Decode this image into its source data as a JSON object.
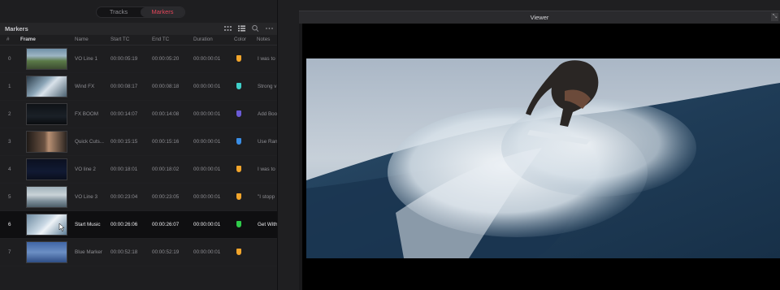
{
  "tabs": {
    "tracks": "Tracks",
    "markers": "Markers"
  },
  "markers_panel": {
    "title": "Markers",
    "columns": {
      "idx": "#",
      "frame": "Frame",
      "name": "Name",
      "start": "Start TC",
      "end": "End TC",
      "duration": "Duration",
      "color": "Color",
      "notes": "Notes"
    },
    "rows": [
      {
        "idx": "0",
        "name": "VO Line 1",
        "start": "00:00:05:19",
        "end": "00:00:05:20",
        "duration": "00:00:00:01",
        "color": "#f2a52b",
        "note": "I was to"
      },
      {
        "idx": "1",
        "name": "Wind FX",
        "start": "00:00:08:17",
        "end": "00:00:08:18",
        "duration": "00:00:00:01",
        "color": "#3fd0c9",
        "note": "Strong v"
      },
      {
        "idx": "2",
        "name": "FX BOOM",
        "start": "00:00:14:07",
        "end": "00:00:14:08",
        "duration": "00:00:00:01",
        "color": "#6b5bd6",
        "note": "Add Boo"
      },
      {
        "idx": "3",
        "name": "Quick Cuts...",
        "start": "00:00:15:15",
        "end": "00:00:15:16",
        "duration": "00:00:00:01",
        "color": "#3a8ee6",
        "note": "Use Ran"
      },
      {
        "idx": "4",
        "name": "VO line 2",
        "start": "00:00:18:01",
        "end": "00:00:18:02",
        "duration": "00:00:00:01",
        "color": "#f2a52b",
        "note": "I was to"
      },
      {
        "idx": "5",
        "name": "VO Line 3",
        "start": "00:00:23:04",
        "end": "00:00:23:05",
        "duration": "00:00:00:01",
        "color": "#f2a52b",
        "note": "\"I stopp"
      },
      {
        "idx": "6",
        "name": "Start Music",
        "start": "00:00:26:06",
        "end": "00:00:26:07",
        "duration": "00:00:00:01",
        "color": "#2fcb4a",
        "note": "Get With"
      },
      {
        "idx": "7",
        "name": "Blue Marker",
        "start": "00:00:52:18",
        "end": "00:00:52:19",
        "duration": "00:00:00:01",
        "color": "#f2a52b",
        "note": ""
      }
    ]
  },
  "viewer": {
    "title": "Viewer"
  }
}
